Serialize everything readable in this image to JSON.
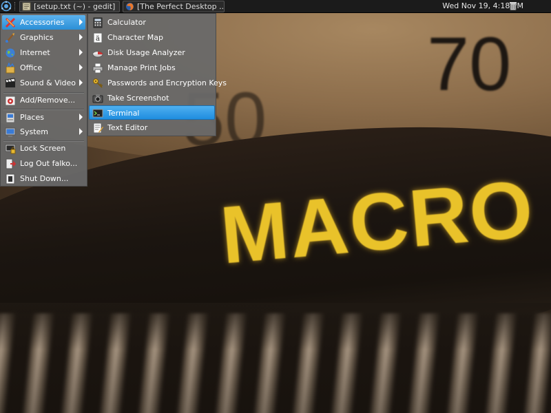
{
  "top_panel": {
    "tasks": [
      {
        "label": "[setup.txt (~) - gedit]",
        "icon": "gedit-icon"
      },
      {
        "label": "[The Perfect Desktop ...",
        "icon": "firefox-icon"
      }
    ],
    "clock": "Wed Nov 19,  4:18 PM"
  },
  "main_menu": {
    "items": [
      {
        "label": "Accessories",
        "icon": "accessories-icon",
        "submenu": true
      },
      {
        "label": "Graphics",
        "icon": "graphics-icon",
        "submenu": true
      },
      {
        "label": "Internet",
        "icon": "internet-icon",
        "submenu": true
      },
      {
        "label": "Office",
        "icon": "office-icon",
        "submenu": true
      },
      {
        "label": "Sound & Video",
        "icon": "sound-video-icon",
        "submenu": true
      },
      {
        "label": "Add/Remove...",
        "icon": "add-remove-icon"
      },
      {
        "label": "Places",
        "icon": "places-icon",
        "submenu": true
      },
      {
        "label": "System",
        "icon": "system-icon",
        "submenu": true
      },
      {
        "label": "Lock Screen",
        "icon": "lock-icon"
      },
      {
        "label": "Log Out falko...",
        "icon": "logout-icon"
      },
      {
        "label": "Shut Down...",
        "icon": "shutdown-icon"
      }
    ]
  },
  "accessories_menu": {
    "items": [
      {
        "label": "Calculator",
        "icon": "calculator-icon"
      },
      {
        "label": "Character Map",
        "icon": "character-map-icon"
      },
      {
        "label": "Disk Usage Analyzer",
        "icon": "disk-usage-icon"
      },
      {
        "label": "Manage Print Jobs",
        "icon": "printer-icon"
      },
      {
        "label": "Passwords and Encryption Keys",
        "icon": "keys-icon"
      },
      {
        "label": "Take Screenshot",
        "icon": "camera-icon"
      },
      {
        "label": "Terminal",
        "icon": "terminal-icon"
      },
      {
        "label": "Text Editor",
        "icon": "text-editor-icon"
      }
    ],
    "highlighted": "Terminal"
  },
  "wallpaper": {
    "text": "MACRO",
    "numbers": [
      "70",
      "50"
    ]
  },
  "colors": {
    "panel_bg": "#1b1b1b",
    "menu_bg": "#696969",
    "highlight": "#2f9be8",
    "wallpaper_text": "#e9c22a"
  }
}
